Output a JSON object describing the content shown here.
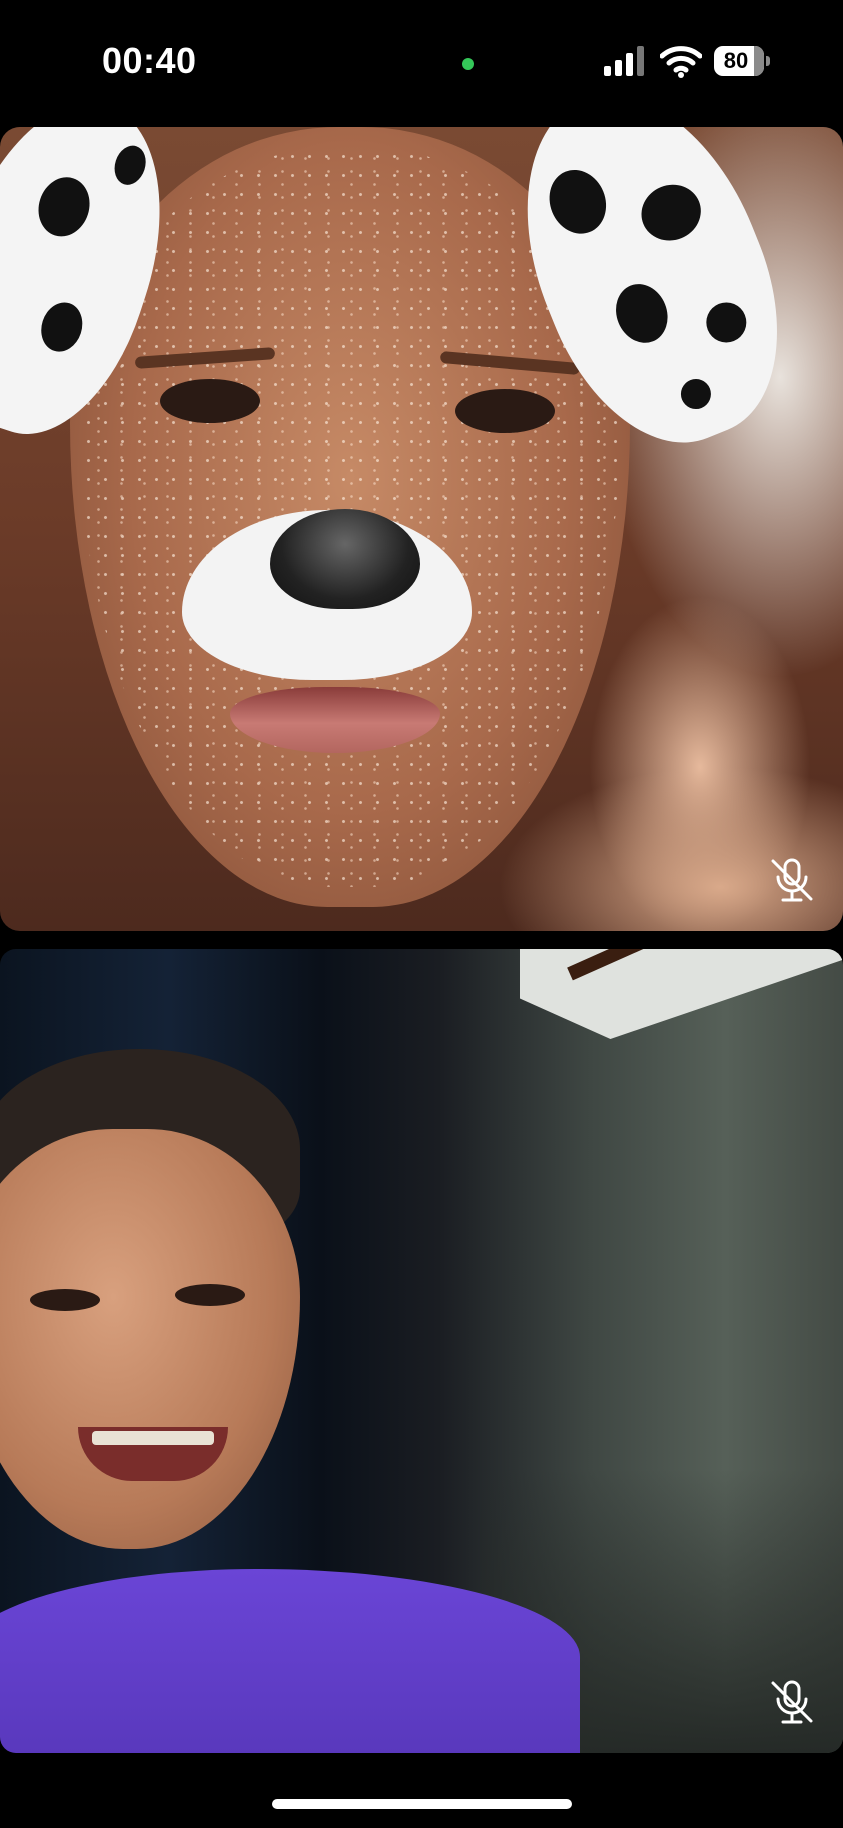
{
  "status_bar": {
    "time": "00:40",
    "battery_level": "80",
    "indicator_color": "#34c759",
    "signal_icon": "cellular-signal-icon",
    "wifi_icon": "wifi-icon"
  },
  "call": {
    "tiles": [
      {
        "id": "remote-participant",
        "filter": "dalmatian-dog-filter",
        "mic_state": "muted",
        "mic_icon": "microphone-muted-icon"
      },
      {
        "id": "local-participant",
        "filter": "none",
        "mic_state": "muted",
        "mic_icon": "microphone-muted-icon"
      }
    ]
  }
}
